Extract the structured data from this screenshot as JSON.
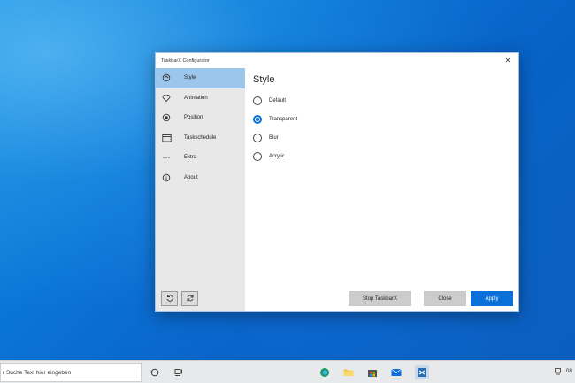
{
  "window": {
    "title": "TaskbarX Configurator",
    "close_glyph": "✕"
  },
  "sidebar": {
    "items": [
      {
        "label": "Style",
        "icon": "brush-icon",
        "selected": true
      },
      {
        "label": "Animation",
        "icon": "heart-icon",
        "selected": false
      },
      {
        "label": "Position",
        "icon": "position-icon",
        "selected": false
      },
      {
        "label": "Taskschedule",
        "icon": "calendar-icon",
        "selected": false
      },
      {
        "label": "Extra",
        "icon": "more-icon",
        "selected": false
      },
      {
        "label": "About",
        "icon": "info-icon",
        "selected": false
      }
    ],
    "bottom_buttons": [
      "undo-icon",
      "refresh-icon"
    ]
  },
  "content": {
    "heading": "Style",
    "options": [
      {
        "label": "Default",
        "checked": false
      },
      {
        "label": "Transparent",
        "checked": true
      },
      {
        "label": "Blur",
        "checked": false
      },
      {
        "label": "Acrylic",
        "checked": false
      }
    ],
    "buttons": {
      "stop": "Stop TaskbarX",
      "close": "Close",
      "apply": "Apply"
    }
  },
  "taskbar": {
    "search_placeholder": "r Suche Text hier eingeben",
    "tray_text": "08"
  },
  "colors": {
    "accent": "#0a6fd6",
    "selected_nav": "#9cc6ec",
    "sidebar_bg": "#e8e8e8"
  }
}
